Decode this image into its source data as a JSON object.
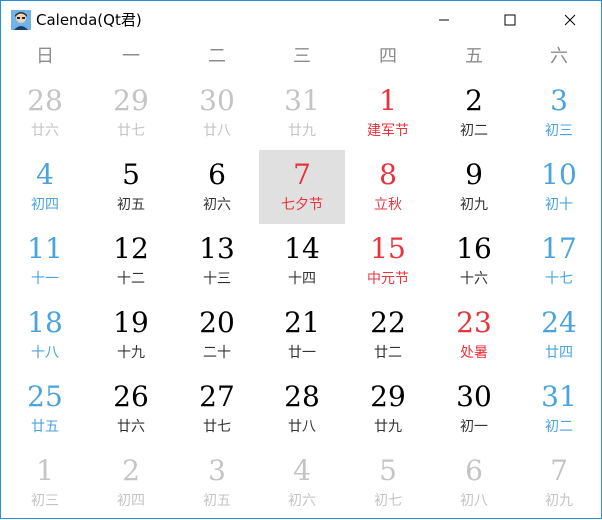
{
  "window": {
    "title": "Calenda(Qt君)"
  },
  "colors": {
    "weekend": "#4aa3df",
    "holiday": "#e8333d",
    "normal": "#000000",
    "normal_lunar": "#333333",
    "muted": "#c4c4c4",
    "header": "#8c8c8c",
    "selected_bg": "#e0e0e0",
    "border": "#2b8fd6"
  },
  "weekdays": [
    "日",
    "一",
    "二",
    "三",
    "四",
    "五",
    "六"
  ],
  "weeks": [
    [
      {
        "day": "28",
        "lunar": "廿六",
        "type": "muted"
      },
      {
        "day": "29",
        "lunar": "廿七",
        "type": "muted"
      },
      {
        "day": "30",
        "lunar": "廿八",
        "type": "muted"
      },
      {
        "day": "31",
        "lunar": "廿九",
        "type": "muted"
      },
      {
        "day": "1",
        "lunar": "建军节",
        "type": "holiday"
      },
      {
        "day": "2",
        "lunar": "初二",
        "type": "normal"
      },
      {
        "day": "3",
        "lunar": "初三",
        "type": "weekend"
      }
    ],
    [
      {
        "day": "4",
        "lunar": "初四",
        "type": "weekend"
      },
      {
        "day": "5",
        "lunar": "初五",
        "type": "normal"
      },
      {
        "day": "6",
        "lunar": "初六",
        "type": "normal"
      },
      {
        "day": "7",
        "lunar": "七夕节",
        "type": "holiday",
        "selected": true
      },
      {
        "day": "8",
        "lunar": "立秋",
        "type": "holiday"
      },
      {
        "day": "9",
        "lunar": "初九",
        "type": "normal"
      },
      {
        "day": "10",
        "lunar": "初十",
        "type": "weekend"
      }
    ],
    [
      {
        "day": "11",
        "lunar": "十一",
        "type": "weekend"
      },
      {
        "day": "12",
        "lunar": "十二",
        "type": "normal"
      },
      {
        "day": "13",
        "lunar": "十三",
        "type": "normal"
      },
      {
        "day": "14",
        "lunar": "十四",
        "type": "normal"
      },
      {
        "day": "15",
        "lunar": "中元节",
        "type": "holiday"
      },
      {
        "day": "16",
        "lunar": "十六",
        "type": "normal"
      },
      {
        "day": "17",
        "lunar": "十七",
        "type": "weekend"
      }
    ],
    [
      {
        "day": "18",
        "lunar": "十八",
        "type": "weekend"
      },
      {
        "day": "19",
        "lunar": "十九",
        "type": "normal"
      },
      {
        "day": "20",
        "lunar": "二十",
        "type": "normal"
      },
      {
        "day": "21",
        "lunar": "廿一",
        "type": "normal"
      },
      {
        "day": "22",
        "lunar": "廿二",
        "type": "normal"
      },
      {
        "day": "23",
        "lunar": "处暑",
        "type": "holiday"
      },
      {
        "day": "24",
        "lunar": "廿四",
        "type": "weekend"
      }
    ],
    [
      {
        "day": "25",
        "lunar": "廿五",
        "type": "weekend"
      },
      {
        "day": "26",
        "lunar": "廿六",
        "type": "normal"
      },
      {
        "day": "27",
        "lunar": "廿七",
        "type": "normal"
      },
      {
        "day": "28",
        "lunar": "廿八",
        "type": "normal"
      },
      {
        "day": "29",
        "lunar": "廿九",
        "type": "normal"
      },
      {
        "day": "30",
        "lunar": "初一",
        "type": "normal"
      },
      {
        "day": "31",
        "lunar": "初二",
        "type": "weekend"
      }
    ],
    [
      {
        "day": "1",
        "lunar": "初三",
        "type": "muted"
      },
      {
        "day": "2",
        "lunar": "初四",
        "type": "muted"
      },
      {
        "day": "3",
        "lunar": "初五",
        "type": "muted"
      },
      {
        "day": "4",
        "lunar": "初六",
        "type": "muted"
      },
      {
        "day": "5",
        "lunar": "初七",
        "type": "muted"
      },
      {
        "day": "6",
        "lunar": "初八",
        "type": "muted"
      },
      {
        "day": "7",
        "lunar": "初九",
        "type": "muted"
      }
    ]
  ],
  "icons": {
    "app": "avatar-icon",
    "minimize": "minimize-icon",
    "maximize": "maximize-icon",
    "close": "close-icon"
  }
}
